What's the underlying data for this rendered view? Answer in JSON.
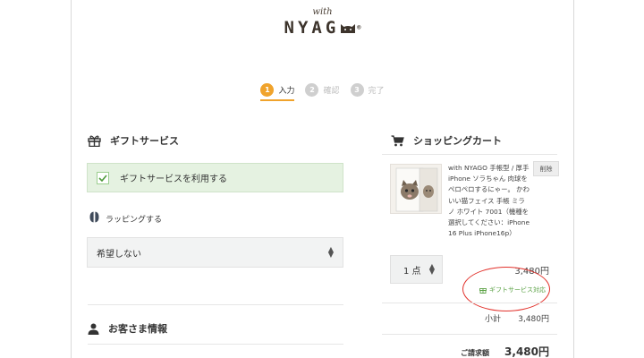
{
  "logo": {
    "with": "with",
    "main": "NYAG",
    "reg": "®"
  },
  "steps": [
    {
      "num": "1",
      "label": "入力",
      "state": "active"
    },
    {
      "num": "2",
      "label": "確認",
      "state": "inactive"
    },
    {
      "num": "3",
      "label": "完了",
      "state": "inactive"
    }
  ],
  "gift": {
    "heading": "ギフトサービス",
    "checkbox_label": "ギフトサービスを利用する",
    "wrapping_label": "ラッピングする",
    "wrapping_select": "希望しない"
  },
  "customer": {
    "heading": "お客さま情報"
  },
  "cart": {
    "heading": "ショッピングカート",
    "product_title": "with NYAGO 手帳型 / 厚手 iPhone ソラちゃん 肉球をペロペロするにゃー。 かわいい猫フェイス 手帳 ミラノ ホワイト 7001（機種を選択してください：iPhone 16 Plus iPhone16p）",
    "delete_label": "削除",
    "quantity": "1 点",
    "price": "3,480円",
    "gift_ok_label": "ギフトサービス対応",
    "subtotal_label": "小計",
    "subtotal_value": "3,480円",
    "total_label": "ご請求額",
    "total_value": "3,480円"
  },
  "colors": {
    "accent": "#f0a32c",
    "gift_green": "#5aa144",
    "annotation_red": "#e2322c"
  }
}
